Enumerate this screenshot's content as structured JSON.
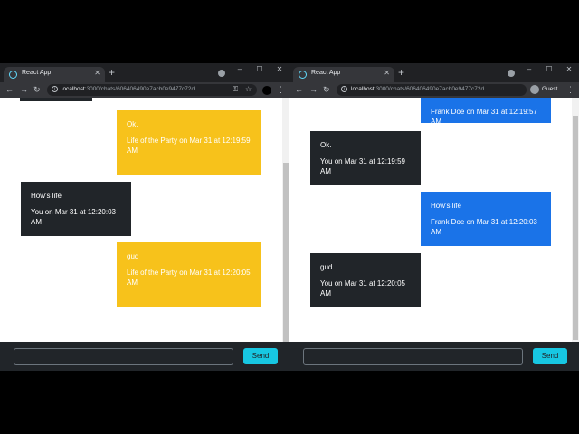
{
  "colors": {
    "yellow": "#f7c21b",
    "dark": "#212529",
    "blue": "#1a73e8",
    "send": "#17c7e2"
  },
  "left": {
    "tab_title": "React App",
    "url_host": "localhost",
    "url_path": ":3000/chats/606406490e7acb0e9477c72d",
    "messages": [
      {
        "text": "Ok.",
        "meta": "Life of the Party on Mar 31 at 12:19:59 AM"
      },
      {
        "text": "How's life",
        "meta": "You on Mar 31 at 12:20:03 AM"
      },
      {
        "text": "gud",
        "meta": "Life of the Party on Mar 31 at 12:20:05 AM"
      }
    ],
    "input_value": "",
    "send_label": "Send"
  },
  "right": {
    "tab_title": "React App",
    "url_host": "localhost",
    "url_path": ":3000/chats/606406490e7acb0e9477c72d",
    "profile_label": "Guest",
    "messages": [
      {
        "text": "",
        "meta": "Frank Doe on Mar 31 at 12:19:57 AM"
      },
      {
        "text": "Ok.",
        "meta": "You on Mar 31 at 12:19:59 AM"
      },
      {
        "text": "How's life",
        "meta": "Frank Doe on Mar 31 at 12:20:03 AM"
      },
      {
        "text": "gud",
        "meta": "You on Mar 31 at 12:20:05 AM"
      }
    ],
    "input_value": "",
    "send_label": "Send"
  }
}
